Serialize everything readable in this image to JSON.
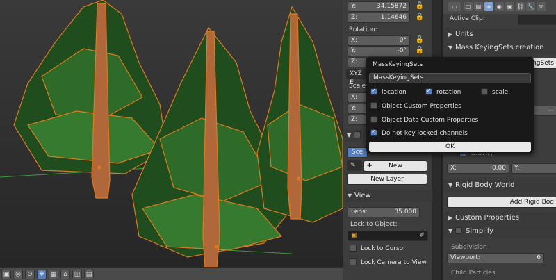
{
  "npanel": {
    "location": {
      "y_label": "Y:",
      "y_value": "34.15872",
      "z_label": "Z:",
      "z_value": "-1.14646"
    },
    "rotation": {
      "label": "Rotation:",
      "x_label": "X:",
      "x_value": "0°",
      "y_label": "Y:",
      "y_value": "-0°",
      "z_label": "Z:"
    },
    "rotation_mode": "XYZ E",
    "scale": {
      "label": "Scale",
      "x_label": "X:",
      "y_label": "Y:",
      "z_label": "Z:"
    },
    "grease_pencil": {
      "tab_scene": "Sce",
      "new_label": "New",
      "new_layer_label": "New Layer"
    },
    "view": {
      "title": "View",
      "lens_label": "Lens:",
      "lens_value": "35.000",
      "lock_to_object_label": "Lock to Object:",
      "lock_to_cursor": "Lock to Cursor",
      "lock_camera_to_view": "Lock Camera to View"
    }
  },
  "props": {
    "active_clip_label": "Active Clip:",
    "units": "Units",
    "mass_keying_sets_creation": "Mass KeyingSets creation",
    "mass_keying_sets_button": "Mass KeyingSets",
    "gravity": "Gravity",
    "gravity_x_label": "X:",
    "gravity_x_value": "0.00",
    "gravity_y_label": "Y:",
    "rigid_body_world": "Rigid Body World",
    "add_rigid_body_button": "Add Rigid Bod",
    "custom_properties": "Custom Properties",
    "simplify": "Simplify",
    "subdivision": "Subdivision",
    "viewport_label": "Viewport:",
    "viewport_value": "6",
    "child_particles": "Child Particles"
  },
  "popup": {
    "title": "MassKeyingSets",
    "name_value": "MassKeyingSets",
    "options": [
      {
        "label": "location",
        "checked": true
      },
      {
        "label": "rotation",
        "checked": true
      },
      {
        "label": "scale",
        "checked": false
      },
      {
        "label": "Object Custom Properties",
        "checked": false
      },
      {
        "label": "Object Data Custom Properties",
        "checked": false
      },
      {
        "label": "Do not key locked channels",
        "checked": true
      }
    ],
    "ok_label": "OK"
  },
  "colors": {
    "accent": "#5680c2",
    "selection_outline": "#e07a1f",
    "foliage": "#2e6b28",
    "trunk": "#b0683a"
  }
}
